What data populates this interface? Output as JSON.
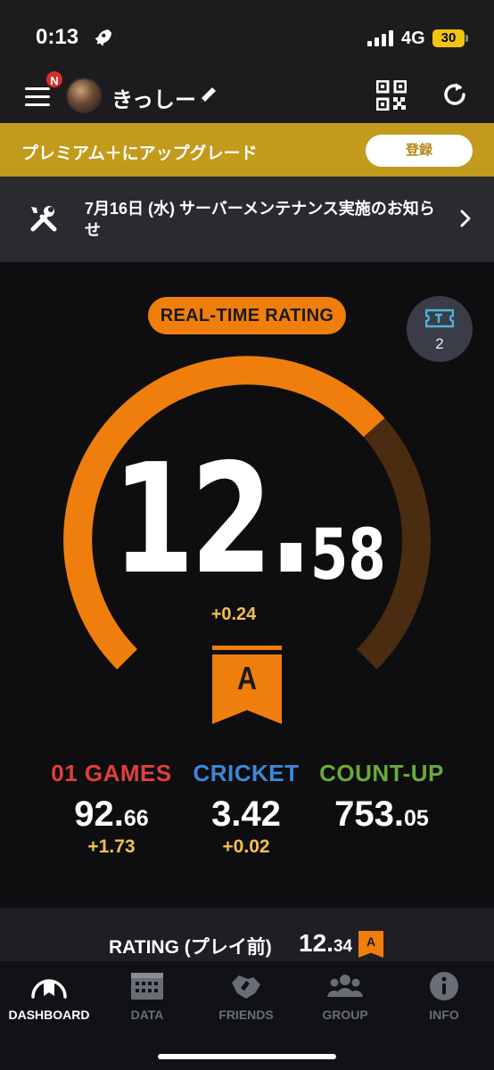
{
  "status": {
    "time": "0:13",
    "network": "4G",
    "battery": "30"
  },
  "header": {
    "notification_badge": "N",
    "username": "きっしー"
  },
  "premium": {
    "text": "プレミアム＋にアップグレード",
    "button": "登録"
  },
  "notice": {
    "text": "7月16日 (水) サーバーメンテナンス実施のお知らせ"
  },
  "rating": {
    "label": "REAL-TIME RATING",
    "integer": "12.",
    "decimal": "58",
    "delta": "+0.24",
    "rank": "A",
    "gauge_progress": 0.68,
    "tickets": "2",
    "colors": {
      "accent": "#f07e0c",
      "track": "#4a2c10",
      "delta": "#f3c14a"
    }
  },
  "stats": [
    {
      "label": "01 GAMES",
      "value_main": "92.",
      "value_sub": "66",
      "delta": "+1.73",
      "color": "#e0403a"
    },
    {
      "label": "CRICKET",
      "value_main": "3.42",
      "value_sub": "",
      "delta": "+0.02",
      "color": "#3d86d9"
    },
    {
      "label": "COUNT-UP",
      "value_main": "753.",
      "value_sub": "05",
      "delta": "",
      "color": "#6aaa3a"
    }
  ],
  "rating_before": {
    "label": "RATING (プレイ前)",
    "value_main": "12.",
    "value_sub": "34",
    "rank": "A"
  },
  "tabs": [
    {
      "label": "DASHBOARD",
      "icon": "dashboard-icon",
      "active": true
    },
    {
      "label": "DATA",
      "icon": "data-icon",
      "active": false
    },
    {
      "label": "FRIENDS",
      "icon": "friends-icon",
      "active": false
    },
    {
      "label": "GROUP",
      "icon": "group-icon",
      "active": false
    },
    {
      "label": "INFO",
      "icon": "info-icon",
      "active": false
    }
  ]
}
